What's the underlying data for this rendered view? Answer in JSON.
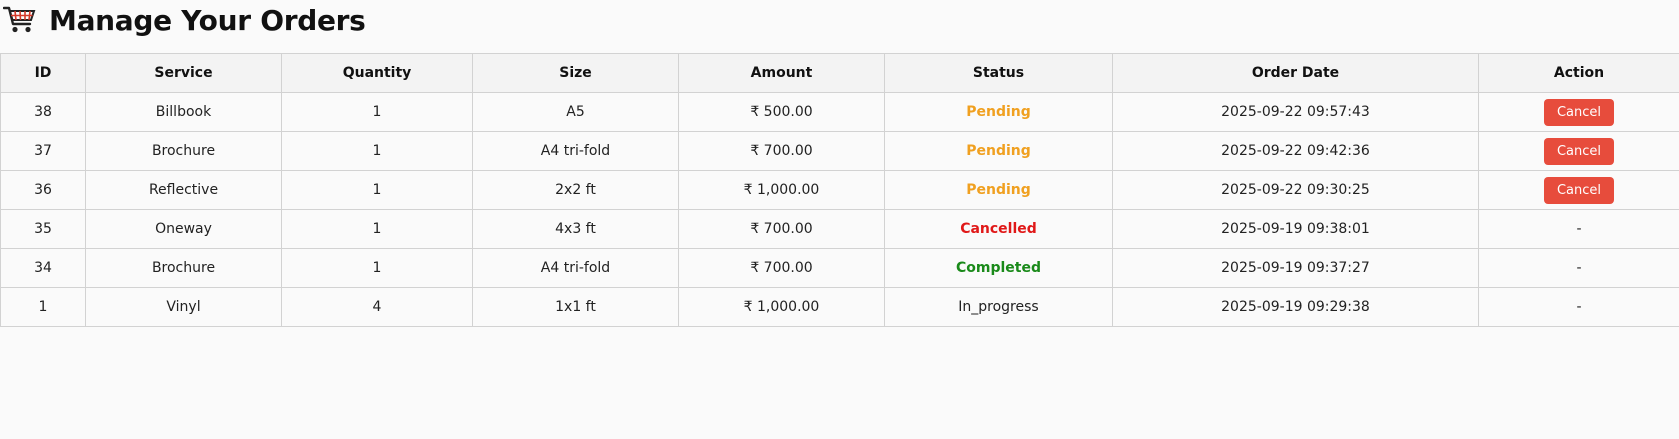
{
  "header": {
    "title": "Manage Your Orders",
    "icon": "shopping-cart-icon"
  },
  "table": {
    "columns": [
      "ID",
      "Service",
      "Quantity",
      "Size",
      "Amount",
      "Status",
      "Order Date",
      "Action"
    ],
    "rows": [
      {
        "id": "38",
        "service": "Billbook",
        "quantity": "1",
        "size": "A5",
        "amount": "₹ 500.00",
        "status": "Pending",
        "status_key": "pending",
        "order_date": "2025-09-22 09:57:43",
        "action": "Cancel",
        "has_button": true
      },
      {
        "id": "37",
        "service": "Brochure",
        "quantity": "1",
        "size": "A4 tri-fold",
        "amount": "₹ 700.00",
        "status": "Pending",
        "status_key": "pending",
        "order_date": "2025-09-22 09:42:36",
        "action": "Cancel",
        "has_button": true
      },
      {
        "id": "36",
        "service": "Reflective",
        "quantity": "1",
        "size": "2x2 ft",
        "amount": "₹ 1,000.00",
        "status": "Pending",
        "status_key": "pending",
        "order_date": "2025-09-22 09:30:25",
        "action": "Cancel",
        "has_button": true
      },
      {
        "id": "35",
        "service": "Oneway",
        "quantity": "1",
        "size": "4x3 ft",
        "amount": "₹ 700.00",
        "status": "Cancelled",
        "status_key": "cancelled",
        "order_date": "2025-09-19 09:38:01",
        "action": "-",
        "has_button": false
      },
      {
        "id": "34",
        "service": "Brochure",
        "quantity": "1",
        "size": "A4 tri-fold",
        "amount": "₹ 700.00",
        "status": "Completed",
        "status_key": "completed",
        "order_date": "2025-09-19 09:37:27",
        "action": "-",
        "has_button": false
      },
      {
        "id": "1",
        "service": "Vinyl",
        "quantity": "4",
        "size": "1x1 ft",
        "amount": "₹ 1,000.00",
        "status": "In_progress",
        "status_key": "in_progress",
        "order_date": "2025-09-19 09:29:38",
        "action": "-",
        "has_button": false
      }
    ]
  },
  "colors": {
    "pending": "#f0a020",
    "cancelled": "#e01818",
    "completed": "#1a8a1a",
    "cancel_button": "#e74c3c"
  }
}
